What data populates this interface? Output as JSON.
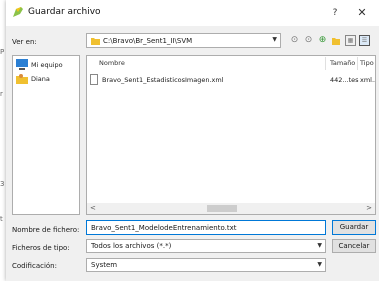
{
  "background": {
    "left_text_1": "P",
    "left_text_2": "r",
    "left_text_3": "3",
    "left_text_4": "t"
  },
  "dialog": {
    "title": "Guardar archivo",
    "help_glyph": "?",
    "close_glyph": "✕"
  },
  "location": {
    "label": "Ver en:",
    "path": "C:\\Bravo\\Br_Sent1_II\\SVM"
  },
  "sidebar": {
    "items": [
      {
        "label": "Mi equipo",
        "icon": "computer-icon"
      },
      {
        "label": "Diana",
        "icon": "user-folder-icon"
      }
    ]
  },
  "file_list": {
    "columns": [
      "Nombre",
      "Tamaño",
      "Tipo"
    ],
    "rows": [
      {
        "name": "Bravo_Sent1_EstadisticosImagen.xml",
        "size": "442...tes",
        "type": "xml..."
      }
    ]
  },
  "filename": {
    "label": "Nombre de fichero:",
    "value": "Bravo_Sent1_ModelodeEntrenamiento.txt"
  },
  "filetype": {
    "label": "Ficheros de tipo:",
    "value": "Todos los archivos (*.*)"
  },
  "encoding": {
    "label": "Codificación:",
    "value": "System"
  },
  "buttons": {
    "save": "Guardar",
    "cancel": "Cancelar"
  },
  "colors": {
    "accent": "#0078d7",
    "folder": "#f0c030"
  }
}
